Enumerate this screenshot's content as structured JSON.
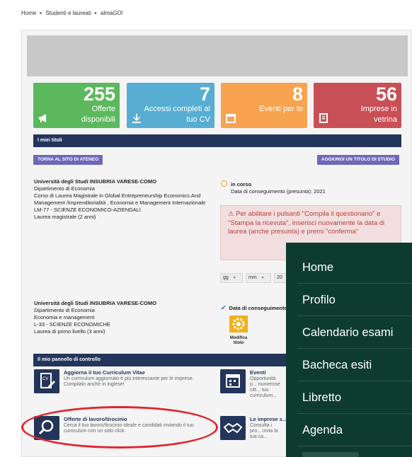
{
  "breadcrumb": {
    "items": [
      "Home",
      "Studenti e laureati",
      "almaGO!"
    ],
    "separator": "▸"
  },
  "stats": [
    {
      "number": "255",
      "label": "Offerte disponibili",
      "icon": "megaphone-icon",
      "color": "#5cb85c"
    },
    {
      "number": "7",
      "label": "Accessi completi al tuo CV",
      "icon": "download-icon",
      "color": "#57aed2"
    },
    {
      "number": "8",
      "label": "Eventi per te",
      "icon": "calendar-icon",
      "color": "#f7a34f"
    },
    {
      "number": "56",
      "label": "Imprese in vetrina",
      "icon": "building-icon",
      "color": "#c94f57"
    }
  ],
  "titles_section": {
    "header": "I miei titoli",
    "back_button": "TORNA AL SITO DI ATENEO",
    "add_button": "AGGIUNGI UN TITOLO DI STUDIO",
    "title1": {
      "university": "Università degli Studi INSUBRIA VARESE-COMO",
      "department": "Dipartimento di Economia",
      "course": "Corso di Laurea Magistrale in Global Entrepreneurship Economics And Management /Imprenditorialità , Economia e Management Internazionale",
      "class": "LM-77 - SCIENZE ECONOMICO-AZIENDALI",
      "degree": "Laurea magistrale (2 anni)"
    },
    "status": {
      "label": "in corso",
      "date": "Data di conseguimento (presunta): 2021"
    },
    "alert_text": "Per abilitare i pulsanti \"Compila il questionario\" e \"Stampa la ricevuta\", inserisci nuovamente la data di laurea (anche presunta) e premi \"conferma\"",
    "date_selects": {
      "day": "gg",
      "month": "mm",
      "year": "20"
    },
    "title2": {
      "university": "Università degli Studi INSUBRIA VARESE-COMO",
      "department": "Dipartimento di Economia",
      "course": "Economia e management",
      "class": "L-33 - SCIENZE ECONOMICHE",
      "degree": "Laurea di primo livello (3 anni)"
    },
    "title2_date_label": "Data di conseguimento",
    "edit_label": "Modifica titolo"
  },
  "control_panel": {
    "header": "Il mio pannello di controllo",
    "items": [
      {
        "title": "Aggiorna il tuo Curriculum Vitae",
        "desc": "Un curriculum aggiornato è più interessante per le imprese. Compilalo anche in inglese!",
        "icon": "cv-icon"
      },
      {
        "title": "Eventi",
        "desc": "Opportunità p... numerose citt... tuo curriculum...",
        "icon": "calendar-icon"
      },
      {
        "title": "Offerte di lavoro/tirocinio",
        "desc": "Cerca il tuo lavoro/tirocinio ideale e candidati inviando il tuo curriculum con un solo click.",
        "icon": "search-icon"
      },
      {
        "title": "Le imprese s...",
        "desc": "Consulta i pro... invia la tua ca...",
        "icon": "handshake-icon"
      }
    ]
  },
  "mobile_menu": {
    "items": [
      "Home",
      "Profilo",
      "Calendario esami",
      "Bacheca esiti",
      "Libretto",
      "Agenda"
    ],
    "background": "#0e3b30"
  },
  "highlight_color": "#e1262f"
}
